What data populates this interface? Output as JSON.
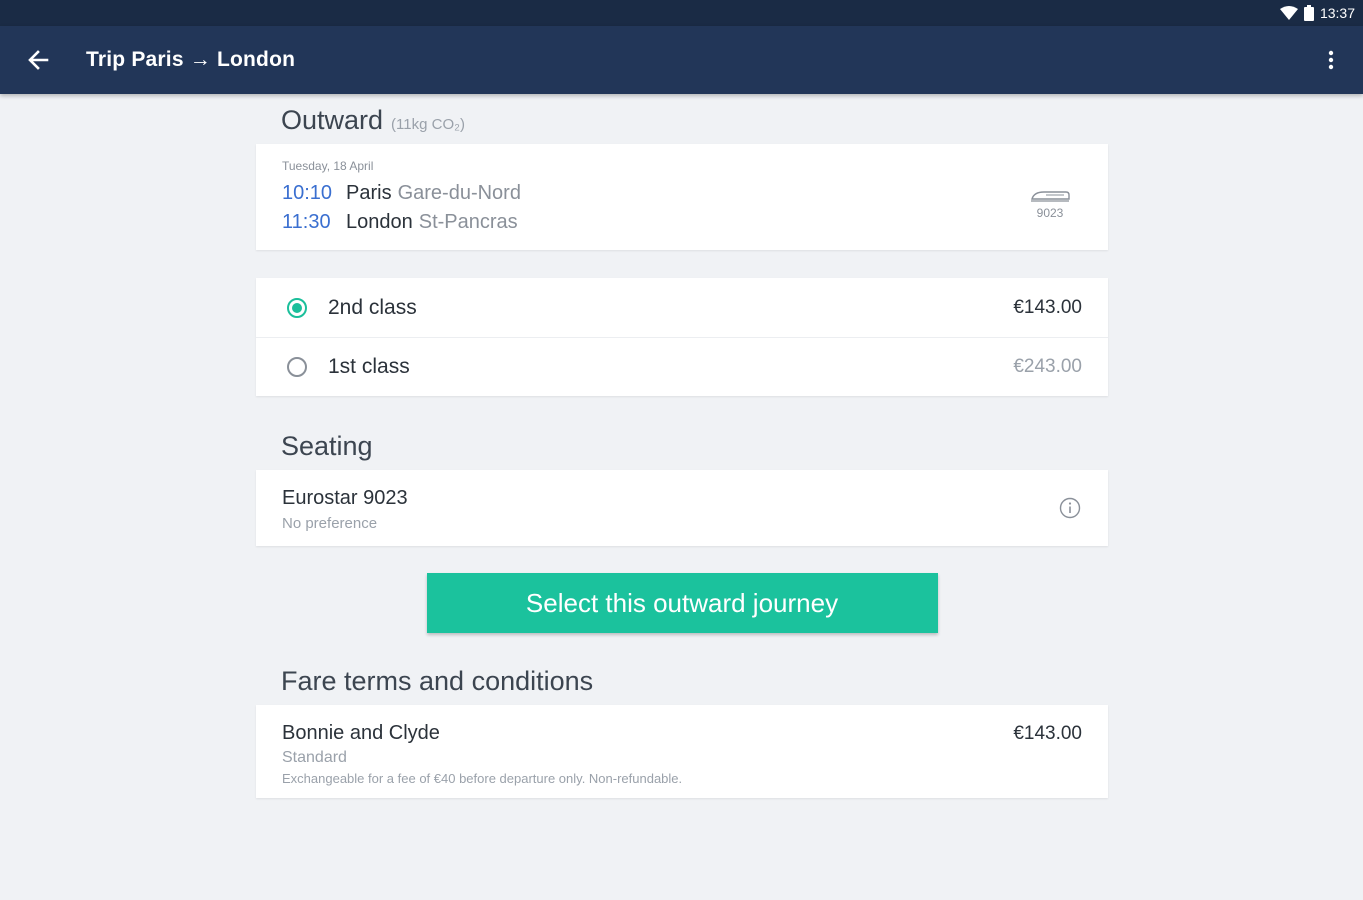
{
  "status_bar": {
    "time": "13:37",
    "icons": [
      "wifi-icon",
      "battery-icon"
    ]
  },
  "app_bar": {
    "title": "Trip Paris → London",
    "back_icon": "arrow-left-icon",
    "menu_icon": "more-vert-icon"
  },
  "outward": {
    "title": "Outward",
    "co2": "(11kg CO₂)",
    "date": "Tuesday, 18 April",
    "departure": {
      "time": "10:10",
      "city": "Paris",
      "station": "Gare-du-Nord"
    },
    "arrival": {
      "time": "11:30",
      "city": "London",
      "station": "St-Pancras"
    },
    "train_number": "9023",
    "train_icon": "train-icon"
  },
  "classes": [
    {
      "label": "2nd class",
      "price": "€143.00",
      "selected": true
    },
    {
      "label": "1st class",
      "price": "€243.00",
      "selected": false
    }
  ],
  "seating": {
    "title": "Seating",
    "train": "Eurostar 9023",
    "preference": "No preference",
    "info_icon": "info-icon"
  },
  "cta": {
    "label": "Select this outward journey"
  },
  "fare": {
    "title": "Fare terms and conditions",
    "name": "Bonnie and Clyde",
    "type": "Standard",
    "description": "Exchangeable for a fee of €40 before departure only. Non-refundable.",
    "price": "€143.00"
  },
  "colors": {
    "accent": "#1bc29d",
    "app_bar": "#223658",
    "status_bar": "#1a2b45",
    "time_blue": "#3a6fd0"
  }
}
